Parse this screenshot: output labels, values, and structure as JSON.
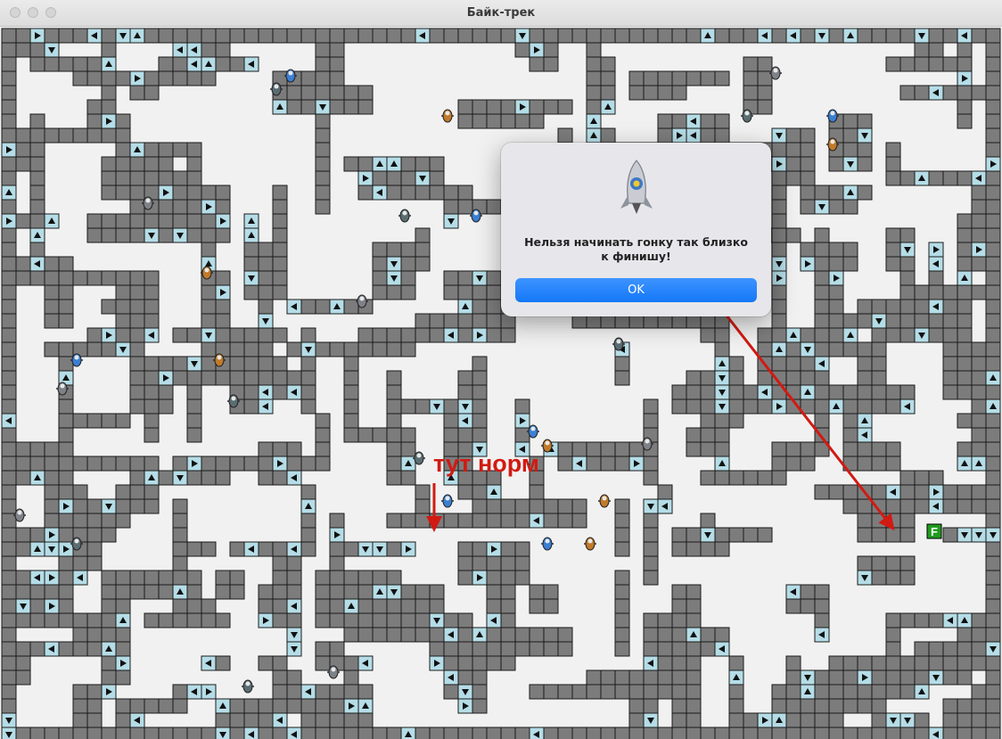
{
  "window": {
    "title": "Байк-трек"
  },
  "colors": {
    "wall": "#7c7c7c",
    "wall_border": "#1a1a1a",
    "arrow_tile": "#b5dde7",
    "floor": "#f1f1f1",
    "finish": "#1f9c1f",
    "annotation": "#d11a12",
    "ok_button": "#1a7cf8"
  },
  "board": {
    "finish_label": "F",
    "wall_icon": "grey-wall-block",
    "arrow_tile_icon": "direction-arrow-tile",
    "bike_icon": "motorbike-rider-icon"
  },
  "dialog": {
    "icon": "rocket-icon",
    "message_line1": "Нельзя начинать гонку так близко",
    "message_line2": "к финишу!",
    "ok_label": "OK"
  },
  "annotation": {
    "text": "тут норм"
  }
}
